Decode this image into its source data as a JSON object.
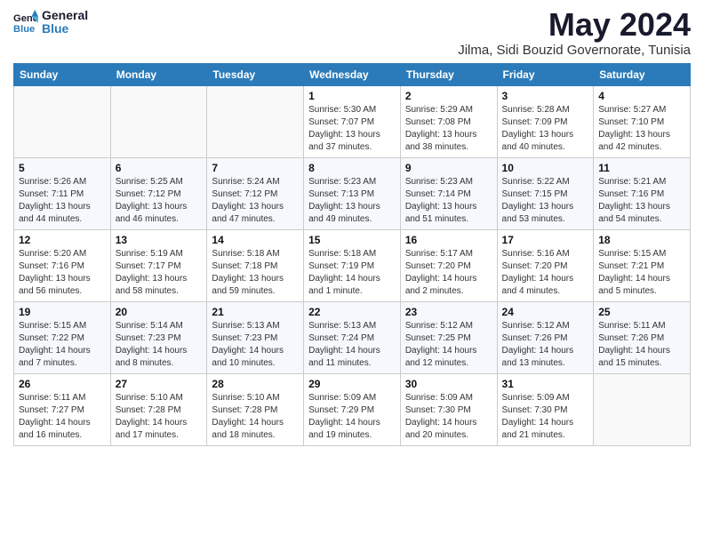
{
  "logo": {
    "line1": "General",
    "line2": "Blue"
  },
  "title": "May 2024",
  "subtitle": "Jilma, Sidi Bouzid Governorate, Tunisia",
  "days_of_week": [
    "Sunday",
    "Monday",
    "Tuesday",
    "Wednesday",
    "Thursday",
    "Friday",
    "Saturday"
  ],
  "weeks": [
    [
      {
        "day": "",
        "info": ""
      },
      {
        "day": "",
        "info": ""
      },
      {
        "day": "",
        "info": ""
      },
      {
        "day": "1",
        "info": "Sunrise: 5:30 AM\nSunset: 7:07 PM\nDaylight: 13 hours and 37 minutes."
      },
      {
        "day": "2",
        "info": "Sunrise: 5:29 AM\nSunset: 7:08 PM\nDaylight: 13 hours and 38 minutes."
      },
      {
        "day": "3",
        "info": "Sunrise: 5:28 AM\nSunset: 7:09 PM\nDaylight: 13 hours and 40 minutes."
      },
      {
        "day": "4",
        "info": "Sunrise: 5:27 AM\nSunset: 7:10 PM\nDaylight: 13 hours and 42 minutes."
      }
    ],
    [
      {
        "day": "5",
        "info": "Sunrise: 5:26 AM\nSunset: 7:11 PM\nDaylight: 13 hours and 44 minutes."
      },
      {
        "day": "6",
        "info": "Sunrise: 5:25 AM\nSunset: 7:12 PM\nDaylight: 13 hours and 46 minutes."
      },
      {
        "day": "7",
        "info": "Sunrise: 5:24 AM\nSunset: 7:12 PM\nDaylight: 13 hours and 47 minutes."
      },
      {
        "day": "8",
        "info": "Sunrise: 5:23 AM\nSunset: 7:13 PM\nDaylight: 13 hours and 49 minutes."
      },
      {
        "day": "9",
        "info": "Sunrise: 5:23 AM\nSunset: 7:14 PM\nDaylight: 13 hours and 51 minutes."
      },
      {
        "day": "10",
        "info": "Sunrise: 5:22 AM\nSunset: 7:15 PM\nDaylight: 13 hours and 53 minutes."
      },
      {
        "day": "11",
        "info": "Sunrise: 5:21 AM\nSunset: 7:16 PM\nDaylight: 13 hours and 54 minutes."
      }
    ],
    [
      {
        "day": "12",
        "info": "Sunrise: 5:20 AM\nSunset: 7:16 PM\nDaylight: 13 hours and 56 minutes."
      },
      {
        "day": "13",
        "info": "Sunrise: 5:19 AM\nSunset: 7:17 PM\nDaylight: 13 hours and 58 minutes."
      },
      {
        "day": "14",
        "info": "Sunrise: 5:18 AM\nSunset: 7:18 PM\nDaylight: 13 hours and 59 minutes."
      },
      {
        "day": "15",
        "info": "Sunrise: 5:18 AM\nSunset: 7:19 PM\nDaylight: 14 hours and 1 minute."
      },
      {
        "day": "16",
        "info": "Sunrise: 5:17 AM\nSunset: 7:20 PM\nDaylight: 14 hours and 2 minutes."
      },
      {
        "day": "17",
        "info": "Sunrise: 5:16 AM\nSunset: 7:20 PM\nDaylight: 14 hours and 4 minutes."
      },
      {
        "day": "18",
        "info": "Sunrise: 5:15 AM\nSunset: 7:21 PM\nDaylight: 14 hours and 5 minutes."
      }
    ],
    [
      {
        "day": "19",
        "info": "Sunrise: 5:15 AM\nSunset: 7:22 PM\nDaylight: 14 hours and 7 minutes."
      },
      {
        "day": "20",
        "info": "Sunrise: 5:14 AM\nSunset: 7:23 PM\nDaylight: 14 hours and 8 minutes."
      },
      {
        "day": "21",
        "info": "Sunrise: 5:13 AM\nSunset: 7:23 PM\nDaylight: 14 hours and 10 minutes."
      },
      {
        "day": "22",
        "info": "Sunrise: 5:13 AM\nSunset: 7:24 PM\nDaylight: 14 hours and 11 minutes."
      },
      {
        "day": "23",
        "info": "Sunrise: 5:12 AM\nSunset: 7:25 PM\nDaylight: 14 hours and 12 minutes."
      },
      {
        "day": "24",
        "info": "Sunrise: 5:12 AM\nSunset: 7:26 PM\nDaylight: 14 hours and 13 minutes."
      },
      {
        "day": "25",
        "info": "Sunrise: 5:11 AM\nSunset: 7:26 PM\nDaylight: 14 hours and 15 minutes."
      }
    ],
    [
      {
        "day": "26",
        "info": "Sunrise: 5:11 AM\nSunset: 7:27 PM\nDaylight: 14 hours and 16 minutes."
      },
      {
        "day": "27",
        "info": "Sunrise: 5:10 AM\nSunset: 7:28 PM\nDaylight: 14 hours and 17 minutes."
      },
      {
        "day": "28",
        "info": "Sunrise: 5:10 AM\nSunset: 7:28 PM\nDaylight: 14 hours and 18 minutes."
      },
      {
        "day": "29",
        "info": "Sunrise: 5:09 AM\nSunset: 7:29 PM\nDaylight: 14 hours and 19 minutes."
      },
      {
        "day": "30",
        "info": "Sunrise: 5:09 AM\nSunset: 7:30 PM\nDaylight: 14 hours and 20 minutes."
      },
      {
        "day": "31",
        "info": "Sunrise: 5:09 AM\nSunset: 7:30 PM\nDaylight: 14 hours and 21 minutes."
      },
      {
        "day": "",
        "info": ""
      }
    ]
  ]
}
